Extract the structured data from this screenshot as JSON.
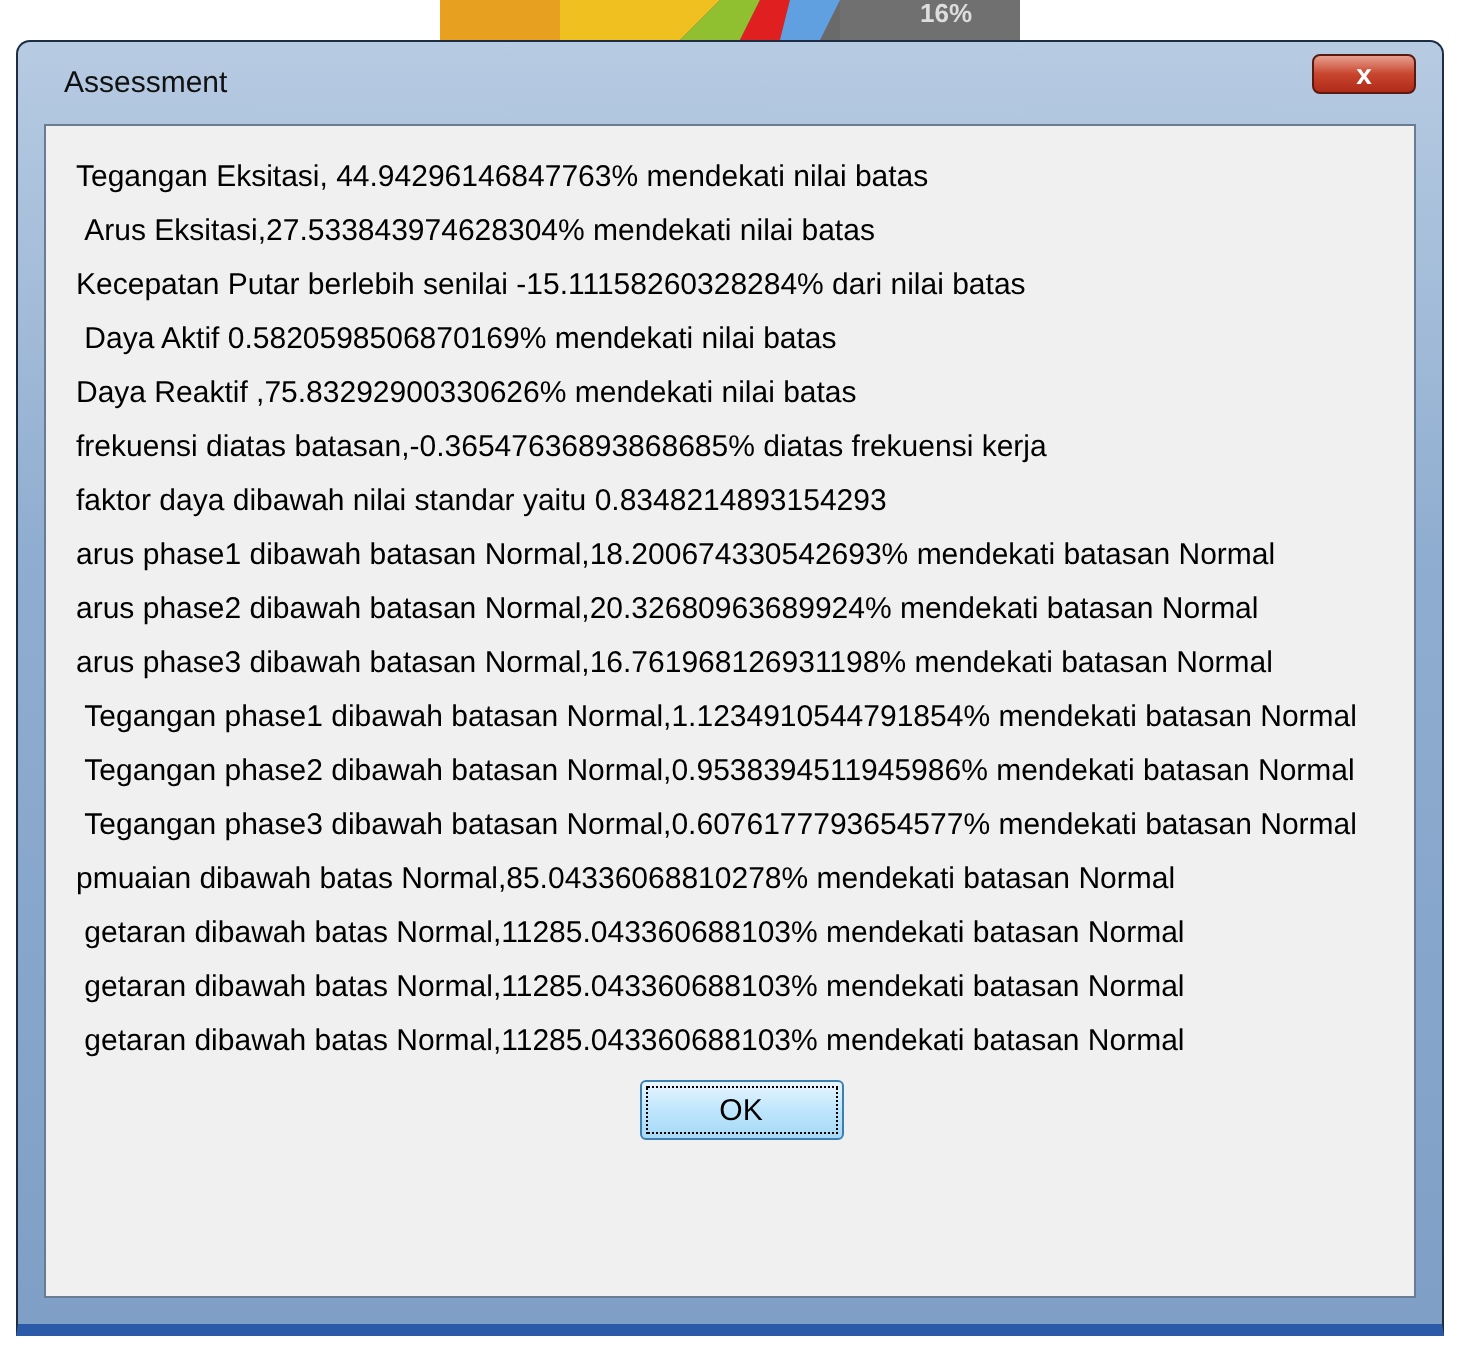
{
  "background": {
    "label": "16%"
  },
  "window": {
    "title": "Assessment",
    "close": "x"
  },
  "messages": [
    "Tegangan Eksitasi, 44.94296146847763% mendekati nilai batas",
    " Arus Eksitasi,27.533843974628304% mendekati nilai batas",
    "Kecepatan Putar berlebih senilai -15.11158260328284% dari nilai batas",
    " Daya Aktif 0.5820598506870169% mendekati nilai batas",
    "Daya Reaktif ,75.83292900330626% mendekati nilai batas",
    "frekuensi diatas batasan,-0.36547636893868685% diatas frekuensi kerja",
    "faktor daya dibawah nilai standar yaitu 0.8348214893154293",
    "arus phase1 dibawah batasan Normal,18.200674330542693% mendekati batasan Normal",
    "arus phase2 dibawah batasan Normal,20.32680963689924% mendekati batasan Normal",
    "arus phase3 dibawah batasan Normal,16.761968126931198% mendekati batasan Normal",
    " Tegangan phase1 dibawah batasan Normal,1.1234910544791854% mendekati batasan Normal",
    " Tegangan phase2 dibawah batasan Normal,0.9538394511945986% mendekati batasan Normal",
    " Tegangan phase3 dibawah batasan Normal,0.6076177793654577% mendekati batasan Normal",
    "pmuaian dibawah batas Normal,85.04336068810278% mendekati batasan Normal",
    " getaran dibawah batas Normal,11285.043360688103% mendekati batasan Normal",
    " getaran dibawah batas Normal,11285.043360688103% mendekati batasan Normal",
    " getaran dibawah batas Normal,11285.043360688103% mendekati batasan Normal"
  ],
  "buttons": [
    "OK"
  ]
}
